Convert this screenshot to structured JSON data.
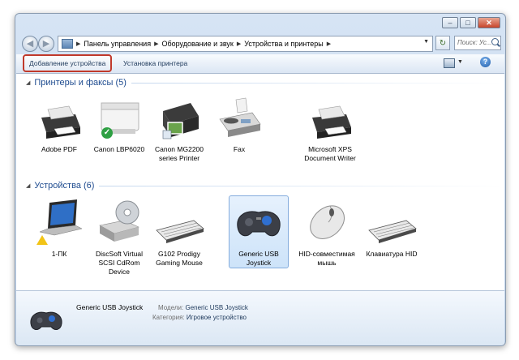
{
  "window": {
    "controls": {
      "minimize": "–",
      "maximize": "□",
      "close": "✕"
    }
  },
  "nav": {
    "breadcrumbs": [
      "Панель управления",
      "Оборудование и звук",
      "Устройства и принтеры"
    ],
    "search_placeholder": "Поиск: Ус...",
    "back_glyph": "◀",
    "forward_glyph": "▶",
    "refresh_glyph": "↻"
  },
  "toolbar": {
    "add_device": "Добавление устройства",
    "install_printer": "Установка принтера",
    "help": "?"
  },
  "groups": {
    "printers": {
      "title": "Принтеры и факсы (5)",
      "items": [
        {
          "label": "Adobe PDF",
          "icon": "printer-icon"
        },
        {
          "label": "Canon LBP6020",
          "icon": "laser-printer-icon",
          "default": true
        },
        {
          "label": "Canon MG2200 series Printer",
          "icon": "inkjet-printer-icon"
        },
        {
          "label": "Fax",
          "icon": "fax-icon"
        },
        {
          "label": "Microsoft XPS Document Writer",
          "icon": "printer-icon"
        }
      ]
    },
    "devices": {
      "title": "Устройства (6)",
      "items": [
        {
          "label": "1-ПК",
          "icon": "laptop-icon",
          "warning": true
        },
        {
          "label": "DiscSoft Virtual SCSI CdRom Device",
          "icon": "cdrom-icon"
        },
        {
          "label": "G102 Prodigy Gaming Mouse",
          "icon": "keyboard-icon"
        },
        {
          "label": "Generic   USB Joystick",
          "icon": "gamepad-icon",
          "selected": true
        },
        {
          "label": "HID-совместимая мышь",
          "icon": "mouse-icon"
        },
        {
          "label": "Клавиатура HID",
          "icon": "keyboard-icon"
        }
      ]
    }
  },
  "details": {
    "name": "Generic   USB  Joystick",
    "model_key": "Модели:",
    "model_value": "Generic   USB  Joystick",
    "category_key": "Категория:",
    "category_value": "Игровое устройство"
  },
  "colors": {
    "accent": "#1e4b8f",
    "highlight_border": "#c0392b",
    "selected_bg": "#cde3f9"
  }
}
